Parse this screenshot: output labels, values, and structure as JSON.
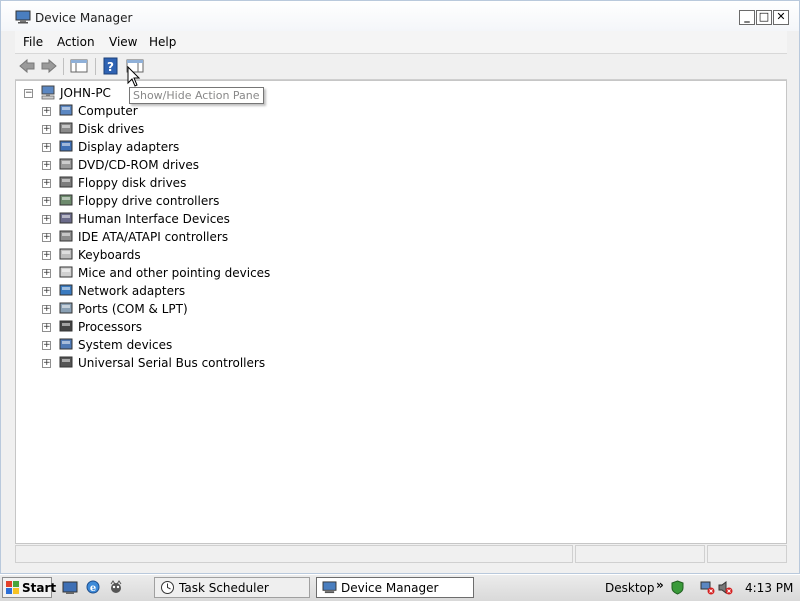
{
  "window": {
    "title": "Device Manager"
  },
  "window_controls": {
    "minimize": "_",
    "maximize": "□",
    "close": "✕"
  },
  "menu": [
    "File",
    "Action",
    "View",
    "Help"
  ],
  "toolbar": {
    "tooltip": "Show/Hide Action Pane"
  },
  "tree": {
    "root": {
      "label": "JOHN-PC",
      "expanded": true
    },
    "items": [
      {
        "label": "Computer",
        "icon": "computer-icon"
      },
      {
        "label": "Disk drives",
        "icon": "disk-drive-icon"
      },
      {
        "label": "Display adapters",
        "icon": "display-adapter-icon"
      },
      {
        "label": "DVD/CD-ROM drives",
        "icon": "dvd-drive-icon"
      },
      {
        "label": "Floppy disk drives",
        "icon": "floppy-drive-icon"
      },
      {
        "label": "Floppy drive controllers",
        "icon": "floppy-controller-icon"
      },
      {
        "label": "Human Interface Devices",
        "icon": "hid-icon"
      },
      {
        "label": "IDE ATA/ATAPI controllers",
        "icon": "ide-controller-icon"
      },
      {
        "label": "Keyboards",
        "icon": "keyboard-icon"
      },
      {
        "label": "Mice and other pointing devices",
        "icon": "mouse-icon"
      },
      {
        "label": "Network adapters",
        "icon": "network-adapter-icon"
      },
      {
        "label": "Ports (COM & LPT)",
        "icon": "port-icon"
      },
      {
        "label": "Processors",
        "icon": "processor-icon"
      },
      {
        "label": "System devices",
        "icon": "system-device-icon"
      },
      {
        "label": "Universal Serial Bus controllers",
        "icon": "usb-icon"
      }
    ]
  },
  "taskbar": {
    "start_label": "Start",
    "tasks": [
      {
        "label": "Task Scheduler",
        "active": false
      },
      {
        "label": "Device Manager",
        "active": true
      }
    ],
    "desktop_label": "Desktop",
    "chevron": "»",
    "clock": "4:13 PM"
  },
  "colors": {
    "accent": "#1f5fbf",
    "selection": "#ffffff",
    "taskbar": "#dcdcdc"
  }
}
